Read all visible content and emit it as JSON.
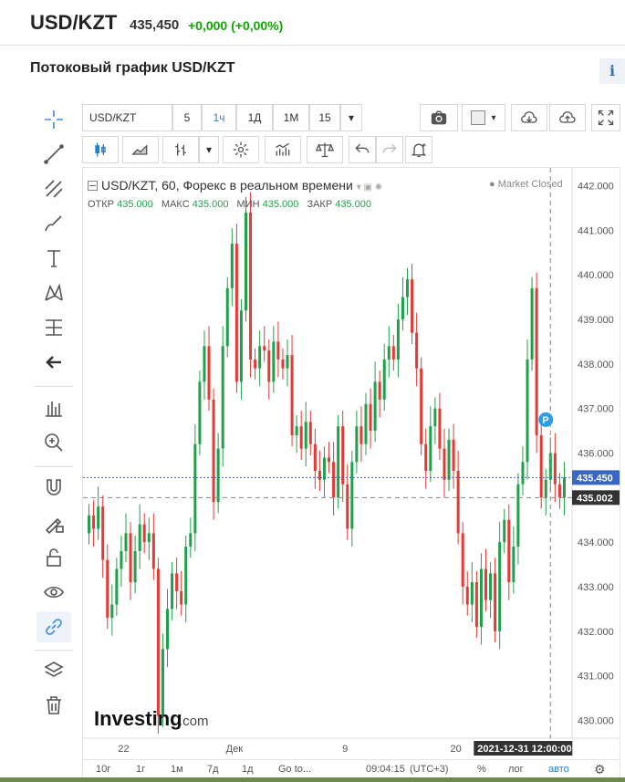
{
  "header": {
    "title": "USD/KZT",
    "price": "435,450",
    "change": "+0,000 (+0,00%)"
  },
  "section": {
    "title": "Потоковый график USD/KZT",
    "info_label": "i"
  },
  "left_tools": [
    {
      "name": "crosshair-icon"
    },
    {
      "name": "trend-line-icon"
    },
    {
      "name": "pitchfork-icon"
    },
    {
      "name": "brush-icon"
    },
    {
      "name": "text-tool-icon"
    },
    {
      "name": "pattern-icon"
    },
    {
      "name": "measure-icon"
    },
    {
      "name": "arrow-left-icon"
    },
    {
      "name": "ruler-icon"
    },
    {
      "name": "zoom-in-icon"
    },
    {
      "name": "magnet-icon"
    },
    {
      "name": "lock-drawing-icon"
    },
    {
      "name": "lock-icon"
    },
    {
      "name": "eye-icon"
    },
    {
      "name": "link-icon"
    },
    {
      "name": "layers-icon"
    },
    {
      "name": "trash-icon"
    }
  ],
  "toolbar": {
    "symbol": "USD/KZT",
    "intervals": [
      "5",
      "1ч",
      "1Д",
      "1М",
      "15"
    ],
    "active_interval": "1ч",
    "dropdown_glyph": "▾"
  },
  "legend": {
    "title": "USD/KZT, 60, Форекс в реальном времени",
    "open_label": "ОТКР",
    "open": "435.000",
    "high_label": "МАКС",
    "high": "435.000",
    "low_label": "МИН",
    "low": "435.000",
    "close_label": "ЗАКР",
    "close": "435.000",
    "status": "Market Closed"
  },
  "chart_data": {
    "type": "candlestick",
    "ylim": [
      429.6,
      442.4
    ],
    "y_ticks": [
      "442.000",
      "441.000",
      "440.000",
      "439.000",
      "438.000",
      "437.000",
      "436.000",
      "435.000",
      "434.000",
      "433.000",
      "432.000",
      "431.000",
      "430.000"
    ],
    "y_tick_values": [
      442,
      441,
      440,
      439,
      438,
      437,
      436,
      435,
      434,
      433,
      432,
      431,
      430
    ],
    "x_labels": [
      "22",
      "Дек",
      "9",
      "20"
    ],
    "x_label_index": [
      8,
      32,
      56,
      80
    ],
    "current_price": "435.450",
    "current_price_value": 435.45,
    "crosshair_price": "435.002",
    "crosshair_price_value": 435.0,
    "crosshair_time": "2021-12-31 12:00:00",
    "marker_label": "P",
    "closes": [
      434.6,
      434.3,
      434.8,
      433.6,
      432.3,
      432.6,
      433.4,
      433.8,
      434.2,
      433.1,
      433.8,
      434.4,
      434.0,
      434.2,
      433.4,
      430.1,
      431.6,
      432.5,
      433.3,
      432.9,
      432.6,
      433.9,
      434.2,
      436.2,
      437.6,
      438.4,
      437.2,
      434.9,
      436.1,
      438.4,
      439.7,
      440.7,
      437.6,
      439.2,
      441.4,
      438.1,
      437.9,
      438.4,
      438.3,
      437.6,
      438.5,
      438.1,
      437.9,
      438.2,
      436.4,
      436.6,
      436.1,
      436.7,
      436.2,
      435.6,
      435.4,
      435.9,
      435.8,
      435.0,
      436.6,
      435.3,
      434.3,
      435.8,
      436.6,
      436.2,
      437.1,
      436.5,
      437.6,
      437.2,
      438.1,
      438.4,
      438.1,
      439.0,
      439.5,
      439.9,
      438.7,
      437.9,
      436.2,
      435.6,
      436.6,
      437.0,
      436.1,
      435.4,
      436.3,
      435.6,
      434.2,
      433.0,
      432.6,
      433.1,
      432.1,
      433.4,
      432.7,
      433.3,
      432.0,
      434.0,
      434.5,
      433.1,
      433.9,
      435.3,
      435.8,
      438.1,
      439.7,
      436.4,
      435.0,
      435.4,
      436.0,
      435.3,
      435.0,
      435.45
    ]
  },
  "bottom_bar": {
    "ranges": [
      "10г",
      "1г",
      "1м",
      "7д",
      "1д",
      "Go to..."
    ],
    "time": "09:04:15",
    "tz": "(UTC+3)",
    "percent": "%",
    "log": "лог",
    "auto": "авто"
  },
  "watermark": {
    "text": "Investing",
    "suffix": ".com"
  },
  "colors": {
    "up": "#21a04b",
    "down": "#e53935",
    "accent": "#2a7fd4",
    "price_line": "#3a66c4"
  }
}
